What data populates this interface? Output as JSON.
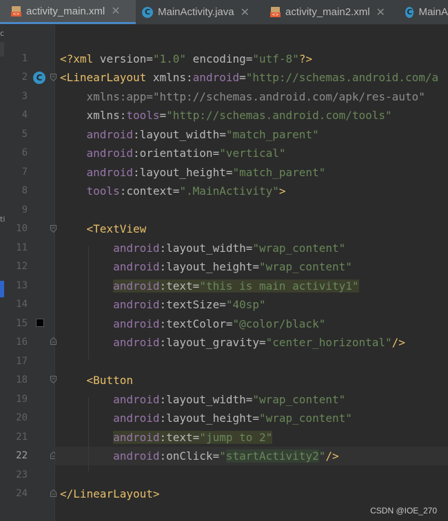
{
  "tabs": [
    {
      "label": "activity_main.xml",
      "icon": "xml-file-icon",
      "active": true
    },
    {
      "label": "MainActivity.java",
      "icon": "java-class-icon",
      "active": false
    },
    {
      "label": "activity_main2.xml",
      "icon": "xml-file-icon",
      "active": false
    },
    {
      "label": "MainA",
      "icon": "java-class-icon",
      "active": false
    }
  ],
  "tool_strip": {
    "letters": [
      "c",
      "ti"
    ]
  },
  "lines": [
    {
      "n": "1"
    },
    {
      "n": "2"
    },
    {
      "n": "3"
    },
    {
      "n": "4"
    },
    {
      "n": "5"
    },
    {
      "n": "6"
    },
    {
      "n": "7"
    },
    {
      "n": "8"
    },
    {
      "n": "9"
    },
    {
      "n": "10"
    },
    {
      "n": "11"
    },
    {
      "n": "12"
    },
    {
      "n": "13"
    },
    {
      "n": "14"
    },
    {
      "n": "15"
    },
    {
      "n": "16"
    },
    {
      "n": "17"
    },
    {
      "n": "18"
    },
    {
      "n": "19"
    },
    {
      "n": "20"
    },
    {
      "n": "21"
    },
    {
      "n": "22"
    },
    {
      "n": "23"
    },
    {
      "n": "24"
    }
  ],
  "current_line": "22",
  "code": {
    "l1": {
      "open": "<?",
      "name": "xml",
      "a1": " version",
      "eq1": "=",
      "v1": "\"1.0\"",
      "a2": " encoding",
      "eq2": "=",
      "v2": "\"utf-8\"",
      "close": "?>"
    },
    "l2": {
      "tag": "<LinearLayout",
      "ns": " xmlns",
      "colon": ":",
      "attr": "android",
      "eq": "=",
      "val": "\"http://schemas.android.com/a"
    },
    "l3": {
      "indent": "    ",
      "attr": "xmlns:app",
      "eq": "=",
      "val": "\"http://schemas.android.com/apk/res-auto\""
    },
    "l4": {
      "indent": "    ",
      "ns": "xmlns",
      "colon": ":",
      "attr": "tools",
      "eq": "=",
      "val": "\"http://schemas.android.com/tools\""
    },
    "l5": {
      "indent": "    ",
      "ns": "android",
      "attr": ":layout_width",
      "eq": "=",
      "val": "\"match_parent\""
    },
    "l6": {
      "indent": "    ",
      "ns": "android",
      "attr": ":orientation",
      "eq": "=",
      "val": "\"vertical\""
    },
    "l7": {
      "indent": "    ",
      "ns": "android",
      "attr": ":layout_height",
      "eq": "=",
      "val": "\"match_parent\""
    },
    "l8": {
      "indent": "    ",
      "ns": "tools",
      "attr": ":context",
      "eq": "=",
      "val": "\".MainActivity\"",
      "close": ">"
    },
    "l10": {
      "indent": "    ",
      "tag": "<TextView"
    },
    "l11": {
      "indent": "        ",
      "ns": "android",
      "attr": ":layout_width",
      "eq": "=",
      "val": "\"wrap_content\""
    },
    "l12": {
      "indent": "        ",
      "ns": "android",
      "attr": ":layout_height",
      "eq": "=",
      "val": "\"wrap_content\""
    },
    "l13": {
      "indent": "        ",
      "ns": "android",
      "attr": ":text",
      "eq": "=",
      "val": "\"this is main activity1\""
    },
    "l14": {
      "indent": "        ",
      "ns": "android",
      "attr": ":textSize",
      "eq": "=",
      "val": "\"40sp\""
    },
    "l15": {
      "indent": "        ",
      "ns": "android",
      "attr": ":textColor",
      "eq": "=",
      "val": "\"@color/black\""
    },
    "l16": {
      "indent": "        ",
      "ns": "android",
      "attr": ":layout_gravity",
      "eq": "=",
      "val": "\"center_horizontal\"",
      "close": "/>"
    },
    "l18": {
      "indent": "    ",
      "tag": "<Button"
    },
    "l19": {
      "indent": "        ",
      "ns": "android",
      "attr": ":layout_width",
      "eq": "=",
      "val": "\"wrap_content\""
    },
    "l20": {
      "indent": "        ",
      "ns": "android",
      "attr": ":layout_height",
      "eq": "=",
      "val": "\"wrap_content\""
    },
    "l21": {
      "indent": "        ",
      "ns": "android",
      "attr": ":text",
      "eq": "=",
      "val": "\"jump to 2\""
    },
    "l22": {
      "indent": "        ",
      "ns": "android",
      "attr": ":onClick",
      "eq": "=",
      "q1": "\"",
      "val": "startActivity2",
      "q2": "\"",
      "close": "/>"
    },
    "l24": {
      "tag": "</LinearLayout>"
    }
  },
  "watermark": "CSDN @IOE_270",
  "colors": {
    "background": "#2b2b2b",
    "gutter": "#313335",
    "tag": "#e8bf6a",
    "namespace": "#9876aa",
    "attribute": "#bababa",
    "string": "#6a8759",
    "accent": "#4a88c7"
  }
}
